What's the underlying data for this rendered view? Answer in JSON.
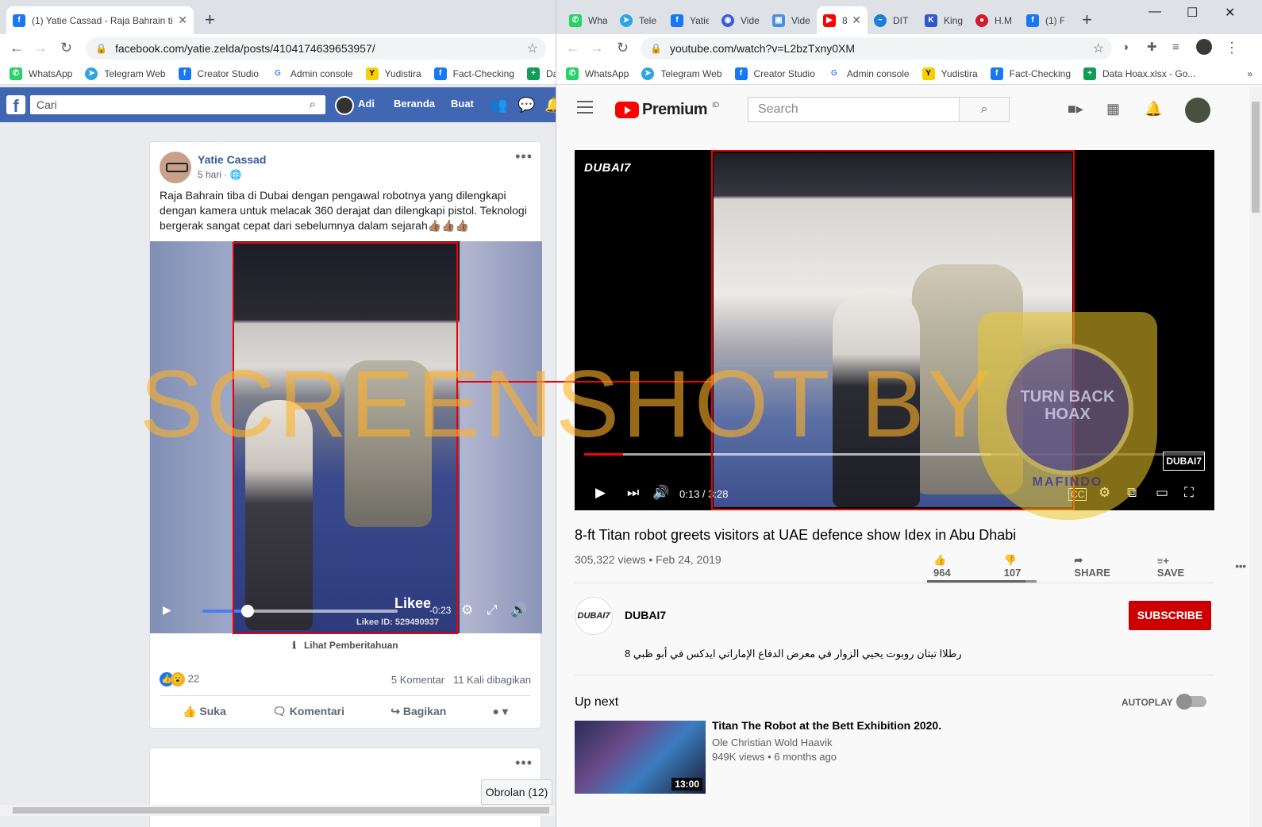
{
  "left": {
    "tab": {
      "title": "(1) Yatie Cassad - Raja Bahrain tib"
    },
    "url": "facebook.com/yatie.zelda/posts/4104174639653957/",
    "bookmarks": [
      "WhatsApp",
      "Telegram Web",
      "Creator Studio",
      "Admin console",
      "Yudistira",
      "Fact-Checking",
      "Data"
    ],
    "fb": {
      "search_placeholder": "Cari",
      "user": "Adi",
      "nav": [
        "Beranda",
        "Buat"
      ],
      "post": {
        "author": "Yatie Cassad",
        "time": "5 hari ·",
        "text": "Raja Bahrain tiba di Dubai dengan pengawal robotnya yang dilengkapi dengan kamera untuk melacak 360 derajat dan dilengkapi pistol. Teknologi bergerak sangat cepat dari sebelumnya dalam sejarah👍🏽👍🏽👍🏽",
        "video": {
          "time": "-0:23",
          "likee": "Likee",
          "likee_id": "Likee ID: 529490937",
          "progress": 0.23
        },
        "notice": "Lihat Pemberitahuan",
        "reaction_count": "22",
        "comments": "5 Komentar",
        "shares": "11 Kali dibagikan",
        "actions": [
          "Suka",
          "Komentari",
          "Bagikan"
        ]
      },
      "chat": "Obrolan (12)"
    }
  },
  "right": {
    "tabs": [
      "Wha",
      "Tele",
      "Yatie",
      "Vide",
      "Vide",
      "8",
      "DIT",
      "King",
      "H.M",
      "(1) F"
    ],
    "url": "youtube.com/watch?v=L2bzTxny0XM",
    "bookmarks": [
      "WhatsApp",
      "Telegram Web",
      "Creator Studio",
      "Admin console",
      "Yudistira",
      "Fact-Checking",
      "Data Hoax.xlsx - Go..."
    ],
    "yt": {
      "logo": "Premium",
      "logo_region": "ID",
      "search_placeholder": "Search",
      "player": {
        "brand": "DUBAI7",
        "time": "0:13 / 3:28",
        "progress": 0.0625
      },
      "title": "8-ft Titan robot greets visitors at UAE defence show Idex in Abu Dhabi",
      "meta": "305,322 views • Feb 24, 2019",
      "likes": "964",
      "dislikes": "107",
      "share": "SHARE",
      "save": "SAVE",
      "channel": "DUBAI7",
      "subscribe": "SUBSCRIBE",
      "description": "رطلاا تيتان روبوت يحيي الزوار في معرض الدفاع الإماراتي ايدكس في أبو ظبي 8",
      "up_next": "Up next",
      "autoplay": "AUTOPLAY",
      "related": {
        "title": "Titan The Robot at the Bett Exhibition 2020.",
        "channel": "Ole Christian Wold Haavik",
        "meta": "949K views • 6 months ago",
        "duration": "13:00"
      }
    }
  },
  "overlay": {
    "watermark": "SCREENSHOT BY",
    "seal_text": "TURN BACK HOAX",
    "seal_arc": "MAFINDO"
  },
  "colors": {
    "fb_blue": "#4267b2",
    "yt_red": "#ff0000",
    "subscribe_red": "#cc0000",
    "box_red": "#ee0000"
  }
}
